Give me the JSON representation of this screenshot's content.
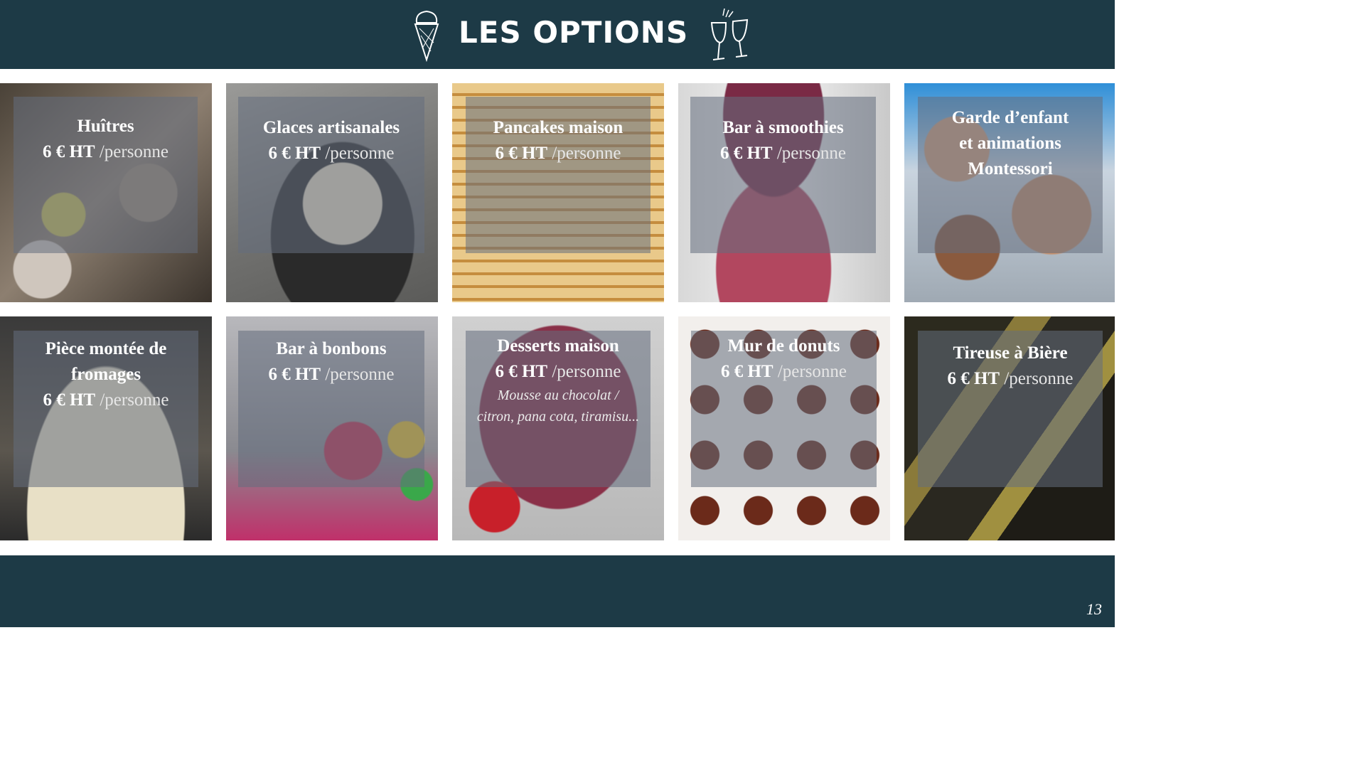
{
  "header": {
    "title": "LES OPTIONS",
    "icons": [
      "ice-cream-cone-icon",
      "wine-glasses-icon"
    ]
  },
  "colors": {
    "header_bg": "#1d3a46",
    "overlay": "rgba(100,110,125,0.55)",
    "text": "#ffffff"
  },
  "options": [
    {
      "title": "Huîtres",
      "price": "6 € HT",
      "unit": "/personne"
    },
    {
      "title": "Glaces artisanales",
      "price": "6 € HT",
      "unit": "/personne"
    },
    {
      "title": "Pancakes maison",
      "price": "6 € HT",
      "unit": "/personne"
    },
    {
      "title": "Bar à smoothies",
      "price": "6 € HT",
      "unit": "/personne"
    },
    {
      "title_lines": [
        "Garde d’enfant",
        "et animations",
        "Montessori"
      ]
    },
    {
      "title_lines": [
        "Pièce montée de",
        "fromages"
      ],
      "price": "6 € HT",
      "unit": "/personne"
    },
    {
      "title": "Bar à bonbons",
      "price": "6 € HT",
      "unit": "/personne"
    },
    {
      "title": "Desserts maison",
      "price": "6 € HT",
      "unit": "/personne",
      "subtitle_lines": [
        "Mousse au chocolat /",
        "citron, pana cota, tiramisu..."
      ]
    },
    {
      "title": "Mur de donuts",
      "price": "6 € HT",
      "unit": "/personne"
    },
    {
      "title": "Tireuse à Bière",
      "price": "6 € HT",
      "unit": "/personne"
    }
  ],
  "footer": {
    "page_number": "13"
  }
}
